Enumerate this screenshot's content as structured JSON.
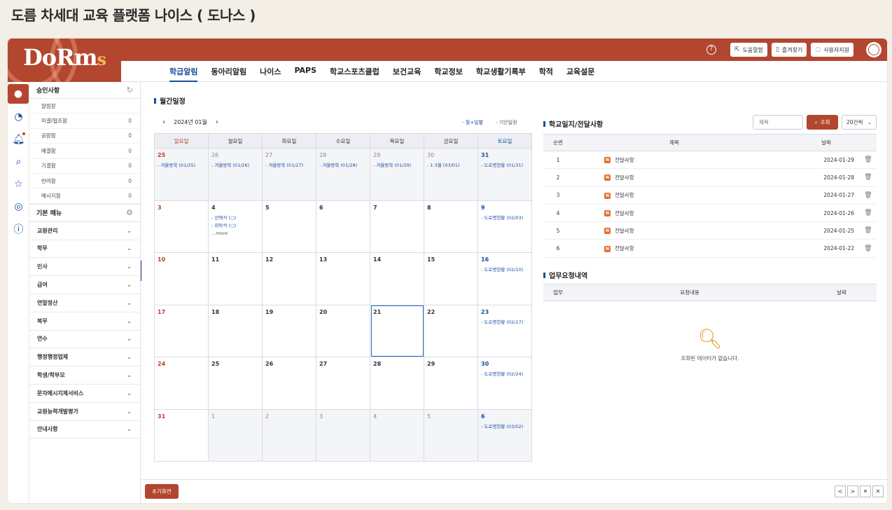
{
  "page_title": "도름 차세대 교육 플랫폼 나이스 ( 도나스 )",
  "logo": {
    "main": "DoRm",
    "accent": "s"
  },
  "top_actions": [
    {
      "label": "도움말함",
      "icon": "link-out-icon"
    },
    {
      "label": "즐겨찾기",
      "icon": "bookmark-icon"
    },
    {
      "label": "사용자지원",
      "icon": "chat-icon"
    }
  ],
  "nav": [
    "학급알림",
    "동아리알림",
    "나이스",
    "PAPS",
    "학교스포츠클럽",
    "보건교육",
    "학교정보",
    "학교생활기록부",
    "학적",
    "교육설문"
  ],
  "nav_active": "학급알림",
  "sidebar": {
    "approval_title": "승인사항",
    "approval_items": [
      {
        "label": "알림장",
        "count": ""
      },
      {
        "label": "미결/협조함",
        "count": "0"
      },
      {
        "label": "공람함",
        "count": "0"
      },
      {
        "label": "예결함",
        "count": "0"
      },
      {
        "label": "기결함",
        "count": "0"
      },
      {
        "label": "반려함",
        "count": "0"
      },
      {
        "label": "메시지함",
        "count": "0"
      }
    ],
    "menu_title": "기본 메뉴",
    "menus": [
      "교원관리",
      "학무",
      "인사",
      "급여",
      "연말정산",
      "복무",
      "연수",
      "행정행정업체",
      "학생/학부모",
      "문자메시지제서비스",
      "교원능력개발평가",
      "안내사항"
    ]
  },
  "calendar": {
    "title": "월간일정",
    "month_label": "2024년 01월",
    "legend": [
      "월+일별",
      "기안일정"
    ],
    "weekdays": [
      "일요일",
      "월요일",
      "화요일",
      "수요일",
      "목요일",
      "금요일",
      "토요일"
    ],
    "weeks": [
      [
        {
          "day": "25",
          "out": true,
          "events": [
            "- 겨울방학 (01/25)"
          ]
        },
        {
          "day": "26",
          "out": true,
          "events": [
            "- 겨울방학 (01/26)"
          ]
        },
        {
          "day": "27",
          "out": true,
          "events": [
            "- 겨울방학 (01/27)"
          ]
        },
        {
          "day": "28",
          "out": true,
          "events": [
            "- 겨울방학 (01/28)"
          ]
        },
        {
          "day": "29",
          "out": true,
          "events": [
            "- 겨울방학 (01/29)"
          ]
        },
        {
          "day": "30",
          "out": true,
          "events": [
            "- 1·3월 (03/01)"
          ]
        },
        {
          "day": "31",
          "out": true,
          "events": [
            "- 도로명현황 (01/31)"
          ]
        }
      ],
      [
        {
          "day": "3",
          "events": []
        },
        {
          "day": "4",
          "events": [
            "- 선택석 (○)",
            "- 위탁석 (○)"
          ],
          "more": "...more"
        },
        {
          "day": "5",
          "events": []
        },
        {
          "day": "6",
          "events": []
        },
        {
          "day": "7",
          "events": []
        },
        {
          "day": "8",
          "events": []
        },
        {
          "day": "9",
          "events": [
            "- 도로명현황 (02/03)"
          ]
        }
      ],
      [
        {
          "day": "10",
          "events": []
        },
        {
          "day": "11",
          "events": []
        },
        {
          "day": "12",
          "events": []
        },
        {
          "day": "13",
          "events": []
        },
        {
          "day": "14",
          "events": []
        },
        {
          "day": "15",
          "events": []
        },
        {
          "day": "16",
          "events": [
            "- 도로명현황 (02/10)"
          ]
        }
      ],
      [
        {
          "day": "17",
          "events": []
        },
        {
          "day": "18",
          "events": []
        },
        {
          "day": "19",
          "events": []
        },
        {
          "day": "20",
          "events": []
        },
        {
          "day": "21",
          "events": [],
          "today": true
        },
        {
          "day": "22",
          "events": []
        },
        {
          "day": "23",
          "events": [
            "- 도로명현황 (02/17)"
          ]
        }
      ],
      [
        {
          "day": "24",
          "events": []
        },
        {
          "day": "25",
          "events": []
        },
        {
          "day": "26",
          "events": []
        },
        {
          "day": "27",
          "events": []
        },
        {
          "day": "28",
          "events": []
        },
        {
          "day": "29",
          "events": []
        },
        {
          "day": "30",
          "events": [
            "- 도로명현황 (02/24)"
          ]
        }
      ],
      [
        {
          "day": "31",
          "events": []
        },
        {
          "day": "1",
          "out": true,
          "events": []
        },
        {
          "day": "2",
          "out": true,
          "events": []
        },
        {
          "day": "3",
          "out": true,
          "events": []
        },
        {
          "day": "4",
          "out": true,
          "events": []
        },
        {
          "day": "5",
          "out": true,
          "events": []
        },
        {
          "day": "6",
          "out": true,
          "events": [
            "- 도로명현황 (03/02)"
          ]
        }
      ]
    ]
  },
  "notices": {
    "title": "학교일지/전달사항",
    "search_placeholder": "제목",
    "search_btn": "조회",
    "page_size": "20건씩",
    "headers": [
      "순번",
      "제목",
      "날짜"
    ],
    "rows": [
      {
        "no": "1",
        "badge": "N",
        "title": "전달사항",
        "date": "2024-01-29"
      },
      {
        "no": "2",
        "badge": "N",
        "title": "전달사항",
        "date": "2024-01-28"
      },
      {
        "no": "3",
        "badge": "N",
        "title": "전달사항",
        "date": "2024-01-27"
      },
      {
        "no": "4",
        "badge": "N",
        "title": "전달사항",
        "date": "2024-01-26"
      },
      {
        "no": "5",
        "badge": "N",
        "title": "전달사항",
        "date": "2024-01-25"
      },
      {
        "no": "6",
        "badge": "N",
        "title": "전달사항",
        "date": "2024-01-22"
      }
    ]
  },
  "requests": {
    "title": "업무요청내역",
    "headers": [
      "업무",
      "요청내용",
      "날짜"
    ],
    "empty_msg": "조회된 데이터가 없습니다."
  },
  "bottom": {
    "reset": "초기화면",
    "pager": [
      "<",
      ">",
      "✕",
      "✕"
    ]
  },
  "colors": {
    "brand": "#b2462e",
    "accent": "#1a4e9c",
    "sunday": "#c0392b"
  }
}
